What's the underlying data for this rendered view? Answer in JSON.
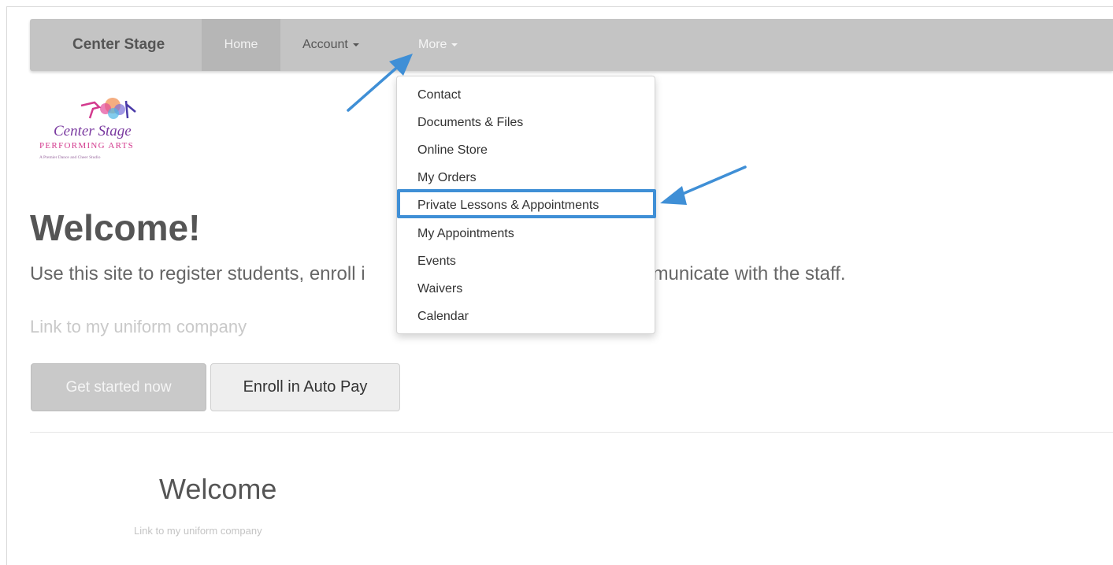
{
  "navbar": {
    "brand": "Center Stage",
    "home": "Home",
    "account": "Account",
    "more": "More"
  },
  "logo": {
    "line1": "Center Stage",
    "line2": "PERFORMING ARTS",
    "line3": "A Premier Dance and Cheer Studio"
  },
  "hero": {
    "title": "Welcome!",
    "lead_left": "Use this site to register students, enroll i",
    "lead_right": "mmunicate with the staff.",
    "uniform_link": "Link to my uniform company",
    "btn_start": "Get started now",
    "btn_autopay": "Enroll in Auto Pay"
  },
  "section2": {
    "title": "Welcome",
    "uniform_link": "Link to my uniform company"
  },
  "more_menu": {
    "items": [
      "Contact",
      "Documents & Files",
      "Online Store",
      "My Orders",
      "Private Lessons & Appointments",
      "My Appointments",
      "Events",
      "Waivers",
      "Calendar"
    ]
  },
  "colors": {
    "navbar_bg": "#c4c4c4",
    "annotation_blue": "#3f8fd6"
  }
}
